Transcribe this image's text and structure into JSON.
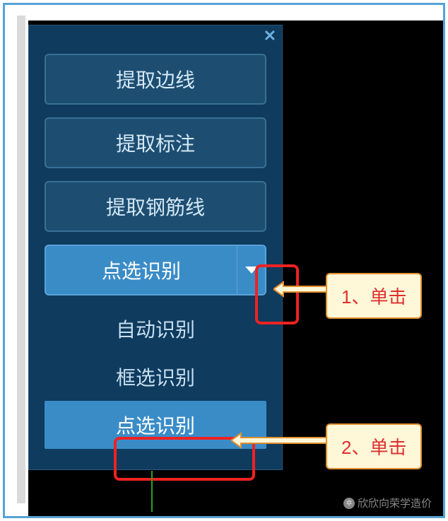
{
  "panel": {
    "close": "✕",
    "buttons": [
      {
        "label": "提取边线"
      },
      {
        "label": "提取标注"
      },
      {
        "label": "提取钢筋线"
      },
      {
        "label": "点选识别",
        "active": true
      }
    ],
    "dropdown": [
      "自动识别",
      "框选识别",
      "点选识别"
    ]
  },
  "callouts": {
    "c1": "1、单击",
    "c2": "2、单击"
  },
  "watermark": {
    "text": "欣欣向荣学造价"
  }
}
